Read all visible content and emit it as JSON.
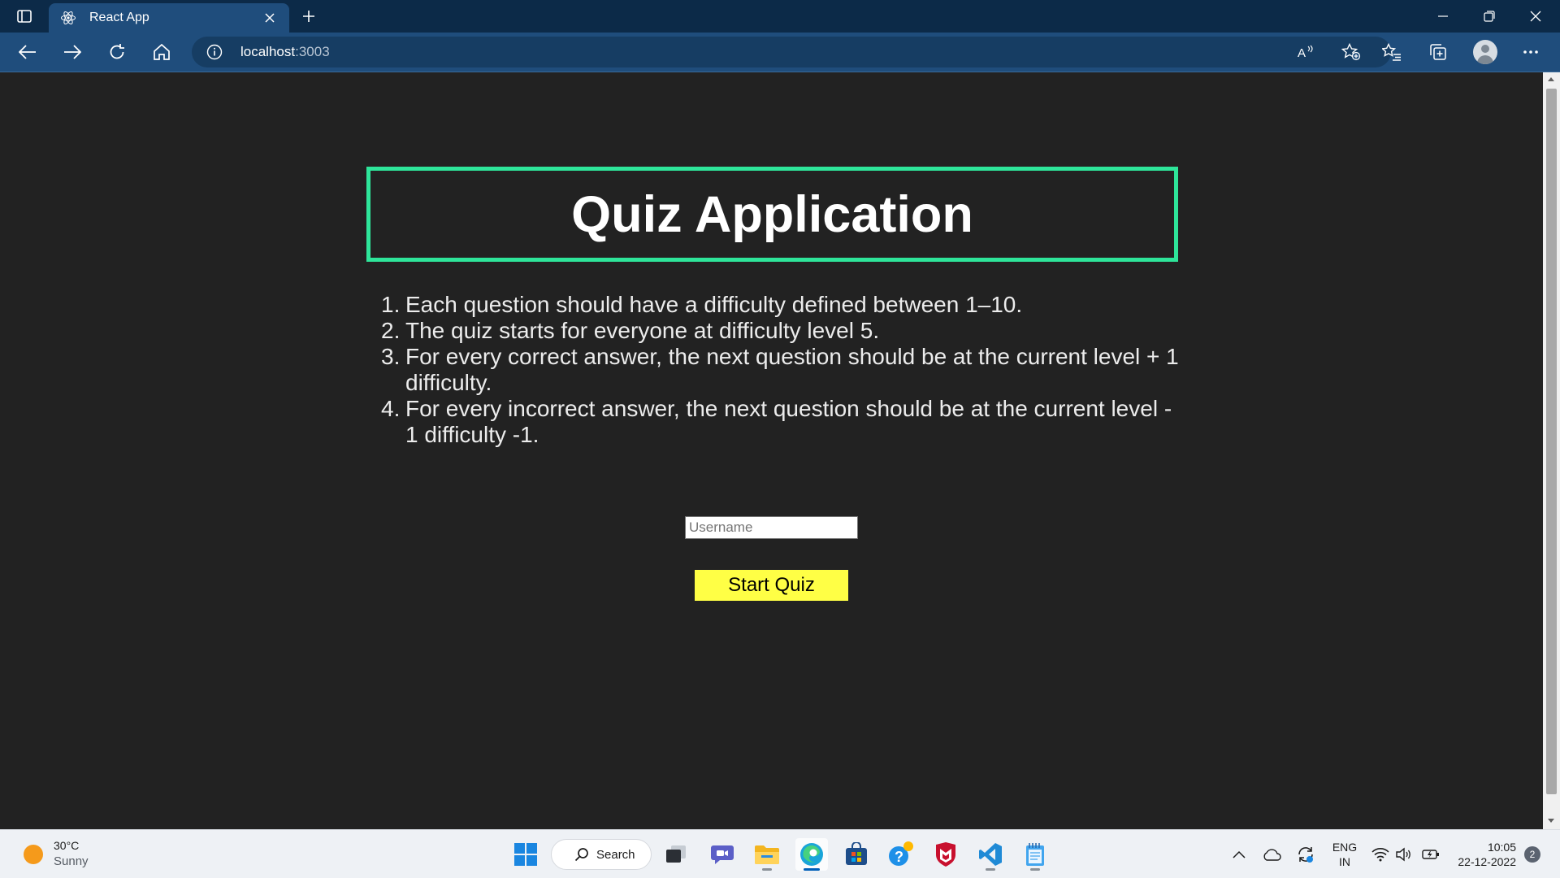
{
  "browser": {
    "tab_title": "React App",
    "url_host": "localhost",
    "url_port": ":3003"
  },
  "page": {
    "title": "Quiz Application",
    "rules": [
      {
        "num": "1.",
        "text": "Each question should have a difficulty defined between 1–10."
      },
      {
        "num": "2.",
        "text": "The quiz starts for everyone at difficulty level 5."
      },
      {
        "num": "3.",
        "text": "For every correct answer, the next question should be at the current level + 1 difficulty."
      },
      {
        "num": "4.",
        "text": "For every incorrect answer, the next question should be at the current level - 1 difficulty -1."
      }
    ],
    "username_placeholder": "Username",
    "username_value": "",
    "start_button": "Start Quiz"
  },
  "taskbar": {
    "weather_temp": "30°C",
    "weather_condition": "Sunny",
    "search_label": "Search",
    "language_line1": "ENG",
    "language_line2": "IN",
    "time": "10:05",
    "date": "22-12-2022",
    "notification_count": "2"
  },
  "colors": {
    "page_background": "#222222",
    "title_border": "#2ee59a",
    "start_button": "#ffff45",
    "browser_frame": "#0c2a48",
    "browser_toolbar": "#1f4d7c"
  }
}
